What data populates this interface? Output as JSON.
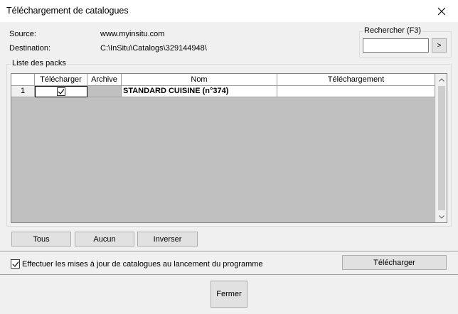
{
  "window": {
    "title": "Téléchargement de catalogues",
    "close_icon": "close-icon"
  },
  "info": {
    "source_label": "Source:",
    "source_value": "www.myinsitu.com",
    "destination_label": "Destination:",
    "destination_value": "C:\\InSitu\\Catalogs\\329144948\\"
  },
  "search": {
    "legend": "Rechercher (F3)",
    "value": "",
    "go_label": ">"
  },
  "packs": {
    "legend": "Liste des packs",
    "columns": [
      "Télécharger",
      "Archive",
      "Nom",
      "Téléchargement"
    ],
    "rows": [
      {
        "index": "1",
        "download": true,
        "archive": "",
        "name": "STANDARD CUISINE (n°374)",
        "progress": ""
      }
    ]
  },
  "selection_buttons": {
    "all": "Tous",
    "none": "Aucun",
    "invert": "Inverser"
  },
  "options": {
    "auto_update_label": "Effectuer les mises à jour de catalogues au lancement du programme",
    "auto_update_checked": true
  },
  "actions": {
    "download": "Télécharger",
    "close": "Fermer"
  },
  "colors": {
    "window_bg": "#f0f0f0",
    "grid_empty_bg": "#c0c0c0",
    "button_bg": "#e1e1e1"
  }
}
